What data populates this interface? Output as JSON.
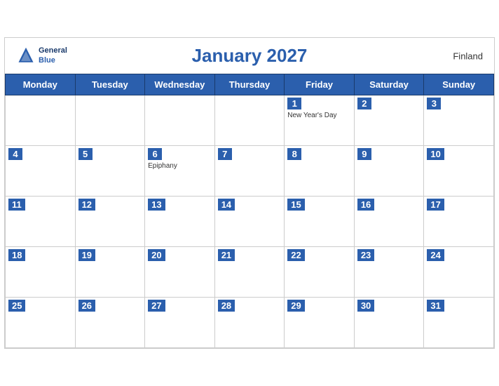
{
  "header": {
    "title": "January 2027",
    "country": "Finland",
    "logo": {
      "general": "General",
      "blue": "Blue"
    }
  },
  "weekdays": [
    "Monday",
    "Tuesday",
    "Wednesday",
    "Thursday",
    "Friday",
    "Saturday",
    "Sunday"
  ],
  "weeks": [
    [
      {
        "day": null
      },
      {
        "day": null
      },
      {
        "day": null
      },
      {
        "day": null
      },
      {
        "day": 1,
        "holiday": "New Year's Day"
      },
      {
        "day": 2
      },
      {
        "day": 3
      }
    ],
    [
      {
        "day": 4
      },
      {
        "day": 5
      },
      {
        "day": 6,
        "holiday": "Epiphany"
      },
      {
        "day": 7
      },
      {
        "day": 8
      },
      {
        "day": 9
      },
      {
        "day": 10
      }
    ],
    [
      {
        "day": 11
      },
      {
        "day": 12
      },
      {
        "day": 13
      },
      {
        "day": 14
      },
      {
        "day": 15
      },
      {
        "day": 16
      },
      {
        "day": 17
      }
    ],
    [
      {
        "day": 18
      },
      {
        "day": 19
      },
      {
        "day": 20
      },
      {
        "day": 21
      },
      {
        "day": 22
      },
      {
        "day": 23
      },
      {
        "day": 24
      }
    ],
    [
      {
        "day": 25
      },
      {
        "day": 26
      },
      {
        "day": 27
      },
      {
        "day": 28
      },
      {
        "day": 29
      },
      {
        "day": 30
      },
      {
        "day": 31
      }
    ]
  ]
}
